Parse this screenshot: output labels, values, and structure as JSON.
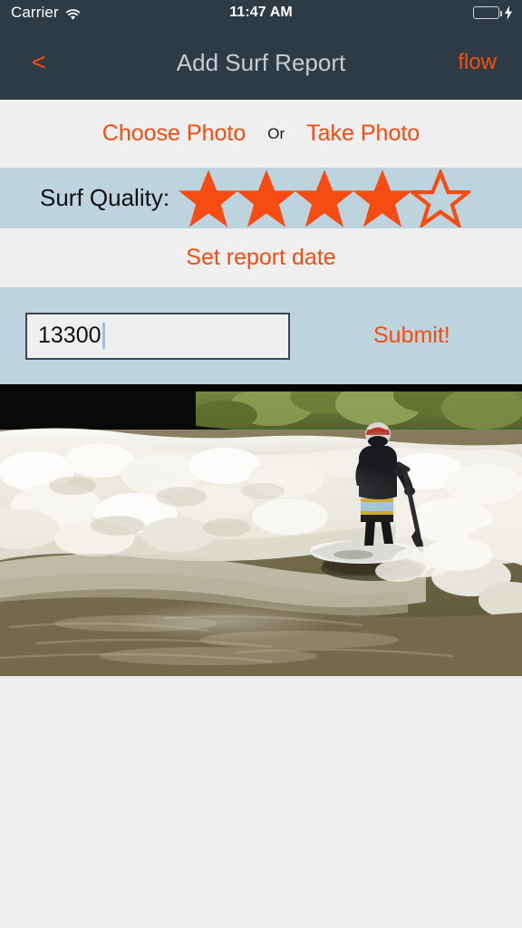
{
  "statusbar": {
    "carrier": "Carrier",
    "wifi_icon": "wifi-icon",
    "time": "11:47 AM",
    "battery_icon": "battery-full-icon",
    "charging_icon": "lightning-bolt-icon"
  },
  "navbar": {
    "back_label": "<",
    "title": "Add Surf Report",
    "right_label": "flow"
  },
  "photo_row": {
    "choose_label": "Choose Photo",
    "or_label": "Or",
    "take_label": "Take Photo"
  },
  "quality_row": {
    "label": "Surf Quality:",
    "rating": 4,
    "max_rating": 5,
    "stars": [
      {
        "state": "filled"
      },
      {
        "state": "filled"
      },
      {
        "state": "filled"
      },
      {
        "state": "filled"
      },
      {
        "state": "empty"
      }
    ]
  },
  "date_row": {
    "set_date_label": "Set report date"
  },
  "submit_row": {
    "flow_value": "13300",
    "flow_placeholder": "",
    "submit_label": "Submit!"
  },
  "photo": {
    "alt": "river surfer on stand-up paddleboard riding a standing wave"
  },
  "colors": {
    "accent": "#f64c12",
    "navbar_bg": "#2e3b45",
    "navbar_title": "#c6cdd2",
    "row_blue": "#bdd4df",
    "row_gray": "#efefef",
    "battery_green": "#4cd964",
    "caret_blue": "#9bbcf0"
  }
}
